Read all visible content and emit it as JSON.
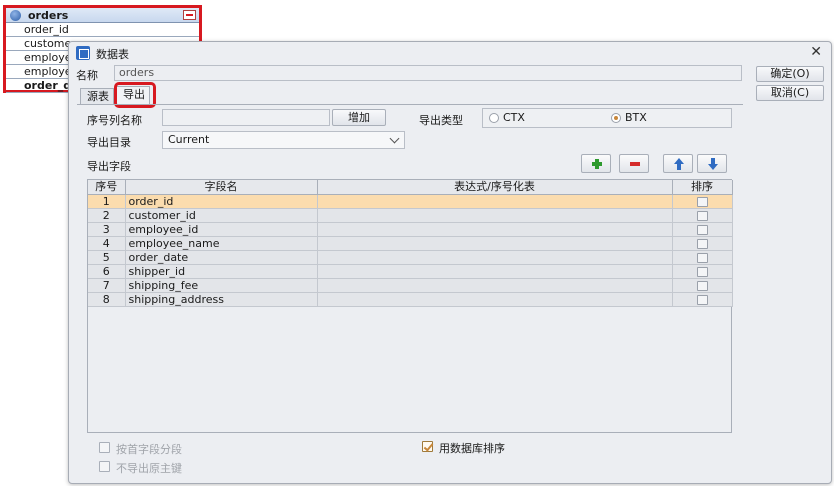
{
  "entity": {
    "name": "orders",
    "rows": [
      "order_id",
      "custome",
      "employe",
      "employe",
      "order_d"
    ]
  },
  "dialog": {
    "title": "数据表",
    "name_label": "名称",
    "name_value": "orders",
    "ok_label": "确定(O)",
    "cancel_label": "取消(C)",
    "tabs": [
      "源表",
      "导出"
    ],
    "seq_col_label": "序号列名称",
    "add_label": "增加",
    "export_type_label": "导出类型",
    "export_type_options": [
      "CTX",
      "BTX"
    ],
    "export_type_selected": "BTX",
    "export_dir_label": "导出目录",
    "export_dir_value": "Current",
    "export_fields_label": "导出字段",
    "icons": [
      "plus-icon",
      "minus-icon",
      "up-arrow-icon",
      "down-arrow-icon"
    ],
    "grid": {
      "headers": [
        "序号",
        "字段名",
        "表达式/序号化表",
        "排序"
      ],
      "rows": [
        {
          "no": "1",
          "field": "order_id",
          "expr": ""
        },
        {
          "no": "2",
          "field": "customer_id",
          "expr": ""
        },
        {
          "no": "3",
          "field": "employee_id",
          "expr": ""
        },
        {
          "no": "4",
          "field": "employee_name",
          "expr": ""
        },
        {
          "no": "5",
          "field": "order_date",
          "expr": ""
        },
        {
          "no": "6",
          "field": "shipper_id",
          "expr": ""
        },
        {
          "no": "7",
          "field": "shipping_fee",
          "expr": ""
        },
        {
          "no": "8",
          "field": "shipping_address",
          "expr": ""
        }
      ],
      "selected_row": 1
    },
    "checkbox_segment": "按首字段分段",
    "checkbox_db_sort": "用数据库排序",
    "checkbox_no_pk": "不导出原主键"
  },
  "colors": {
    "highlight": "#d71920",
    "selected_row": "#fbdcae",
    "accent": "#c8873a"
  }
}
